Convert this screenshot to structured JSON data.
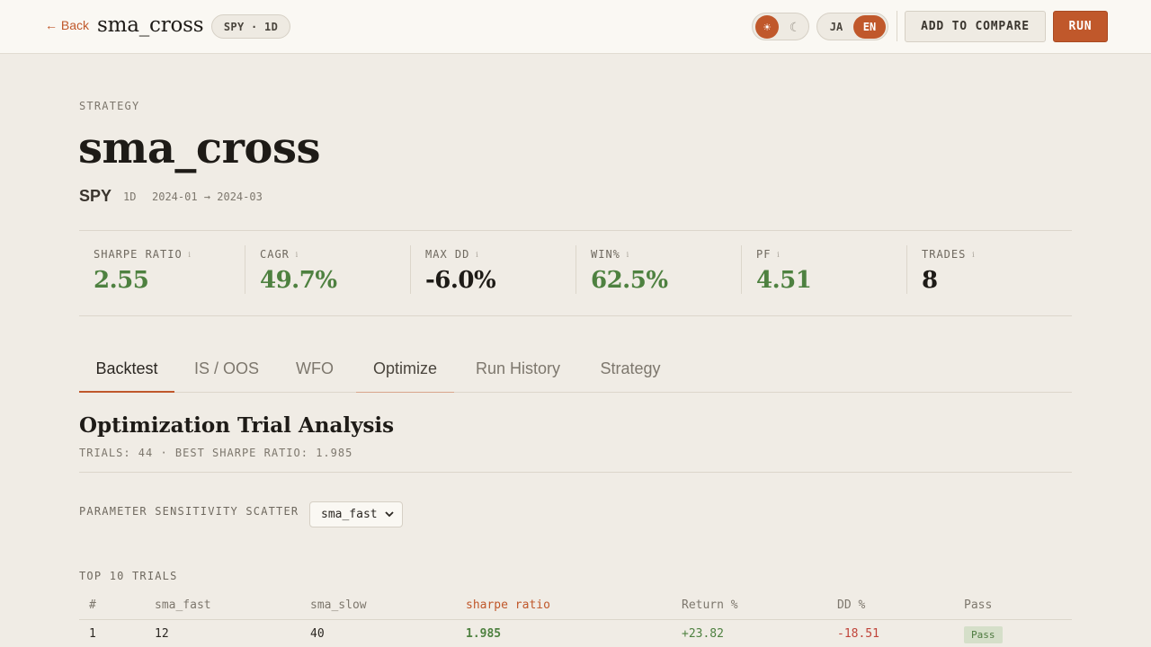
{
  "topbar": {
    "back_label": "← Back",
    "title": "sma_cross",
    "symbol_badge": "SPY · 1D",
    "theme": {
      "light_glyph": "☀",
      "dark_glyph": "☾",
      "active": "light"
    },
    "lang": {
      "ja": "JA",
      "en": "EN",
      "active": "EN"
    },
    "compare_label": "ADD TO COMPARE",
    "run_label": "RUN",
    "accent_color": "#c0582b"
  },
  "header": {
    "eyebrow": "STRATEGY",
    "title": "sma_cross",
    "symbol": "SPY",
    "timeframe": "1D",
    "date_range": "2024-01 → 2024-03"
  },
  "metrics": [
    {
      "label": "SHARPE RATIO",
      "value": "2.55",
      "tone": "pos"
    },
    {
      "label": "CAGR",
      "value": "49.7%",
      "tone": "pos"
    },
    {
      "label": "MAX DD",
      "value": "-6.0%",
      "tone": "neutral"
    },
    {
      "label": "WIN%",
      "value": "62.5%",
      "tone": "pos"
    },
    {
      "label": "PF",
      "value": "4.51",
      "tone": "pos"
    },
    {
      "label": "TRADES",
      "value": "8",
      "tone": "neutral"
    }
  ],
  "tabs": [
    {
      "label": "Backtest",
      "state": "active"
    },
    {
      "label": "IS / OOS",
      "state": ""
    },
    {
      "label": "WFO",
      "state": ""
    },
    {
      "label": "Optimize",
      "state": "selected"
    },
    {
      "label": "Run History",
      "state": ""
    },
    {
      "label": "Strategy",
      "state": ""
    }
  ],
  "optimize": {
    "title": "Optimization Trial Analysis",
    "subtitle": "TRIALS: 44 · BEST SHARPE RATIO: 1.985",
    "scatter_label": "PARAMETER SENSITIVITY SCATTER",
    "scatter_param": "sma_fast",
    "top_label": "TOP 10 TRIALS",
    "columns": [
      "#",
      "sma_fast",
      "sma_slow",
      "sharpe ratio",
      "Return %",
      "DD %",
      "Pass"
    ],
    "rows": [
      {
        "rank": "1",
        "sma_fast": "12",
        "sma_slow": "40",
        "sharpe": "1.985",
        "return": "+23.82",
        "dd": "-18.51",
        "pass": "Pass"
      }
    ]
  }
}
